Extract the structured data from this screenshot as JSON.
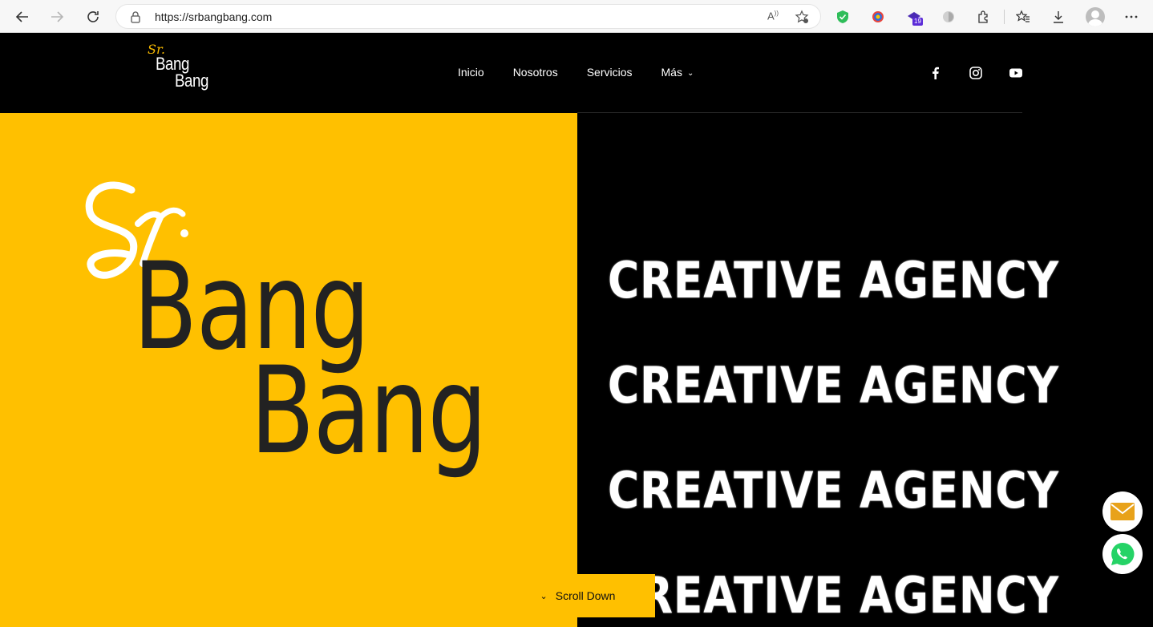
{
  "browser": {
    "url": "https://srbangbang.com",
    "extension_badge": "19"
  },
  "site": {
    "logo": {
      "sr": "Sr.",
      "line1": "Bang",
      "line2": "Bang"
    },
    "menu": [
      {
        "label": "Inicio"
      },
      {
        "label": "Nosotros"
      },
      {
        "label": "Servicios"
      },
      {
        "label": "Más"
      }
    ],
    "social": [
      "facebook-icon",
      "instagram-icon",
      "youtube-icon"
    ]
  },
  "hero": {
    "left_color": "#ffc000",
    "big_logo": {
      "line1": "Bang",
      "line2": "Bang"
    },
    "marquee": [
      "CREATIVE AGENCY",
      "CREATIVE AGENCY",
      "CREATIVE AGENCY",
      "CREATIVE AGENCY"
    ],
    "scroll_label": "Scroll Down"
  },
  "floating": [
    "email-icon",
    "whatsapp-icon"
  ]
}
